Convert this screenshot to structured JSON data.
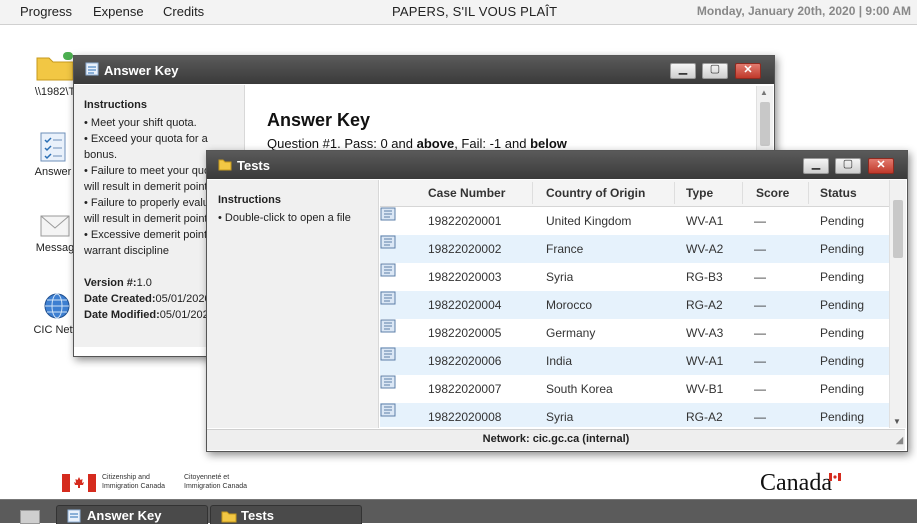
{
  "menubar": {
    "items": [
      "Progress",
      "Expense",
      "Credits"
    ],
    "title": "PAPERS, S'IL VOUS PLAÎT",
    "datetime": "Monday, January 20th, 2020 | 9:00 AM"
  },
  "desktop": {
    "icons": [
      {
        "label": "\\\\1982\\T",
        "icon": "folder-icon"
      },
      {
        "label": "Answer",
        "icon": "checklist-icon"
      },
      {
        "label": "Messag",
        "icon": "envelope-icon"
      },
      {
        "label": "CIC Netw",
        "icon": "globe-icon"
      }
    ]
  },
  "answer_key_window": {
    "title": "Answer Key",
    "instructions_heading": "Instructions",
    "rules": [
      "• Meet your shift quota.",
      "• Exceed your quota for a",
      "bonus.",
      "• Failure to meet your quo",
      "will result in demerit points",
      "• Failure to properly evalu",
      "will result in demerit points",
      "• Excessive demerit points",
      "warrant discipline"
    ],
    "version_label": "Version #:",
    "version": "1.0",
    "created_label": "Date Created:",
    "created": "05/01/2020",
    "modified_label": "Date Modified:",
    "modified": "05/01/202",
    "content_heading": "Answer Key",
    "question": {
      "prefix": "Question #1. Pass: 0 and ",
      "above": "above",
      "middle": ", Fail: -1 and ",
      "below": "below"
    }
  },
  "tests_window": {
    "title": "Tests",
    "instructions_heading": "Instructions",
    "instruction": "• Double-click to open a file",
    "columns": [
      "Case Number",
      "Country of Origin",
      "Type",
      "Score",
      "Status"
    ],
    "rows": [
      {
        "case": "19822020001",
        "country": "United Kingdom",
        "type": "WV-A1",
        "score": "—",
        "status": "Pending"
      },
      {
        "case": "19822020002",
        "country": "France",
        "type": "WV-A2",
        "score": "—",
        "status": "Pending"
      },
      {
        "case": "19822020003",
        "country": "Syria",
        "type": "RG-B3",
        "score": "—",
        "status": "Pending"
      },
      {
        "case": "19822020004",
        "country": "Morocco",
        "type": "RG-A2",
        "score": "—",
        "status": "Pending"
      },
      {
        "case": "19822020005",
        "country": "Germany",
        "type": "WV-A3",
        "score": "—",
        "status": "Pending"
      },
      {
        "case": "19822020006",
        "country": "India",
        "type": "WV-A1",
        "score": "—",
        "status": "Pending"
      },
      {
        "case": "19822020007",
        "country": "South Korea",
        "type": "WV-B1",
        "score": "—",
        "status": "Pending"
      },
      {
        "case": "19822020008",
        "country": "Syria",
        "type": "RG-A2",
        "score": "—",
        "status": "Pending"
      }
    ],
    "network": "Network: cic.gc.ca (internal)"
  },
  "footer": {
    "gov_en_1": "Citizenship and",
    "gov_en_2": "Immigration Canada",
    "gov_fr_1": "Citoyenneté et",
    "gov_fr_2": "Immigration Canada",
    "wordmark": "Canada"
  },
  "taskbar": {
    "tasks": [
      "Answer Key",
      "Tests"
    ]
  },
  "colors": {
    "titlebar": "#3a3a3a",
    "row_alt": "#e6f2fc",
    "flag_red": "#d52b1e",
    "folder": "#f2c744"
  }
}
